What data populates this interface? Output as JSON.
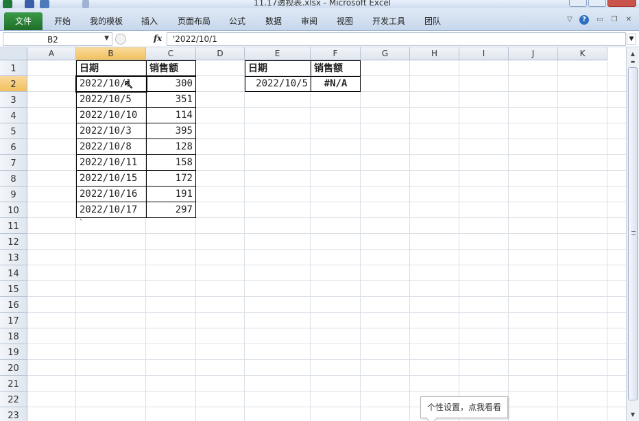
{
  "window": {
    "title": "11.17透视表.xlsx - Microsoft Excel",
    "accent": "#217346"
  },
  "ribbon": {
    "file_tab": "文件",
    "tabs": [
      "开始",
      "我的模板",
      "插入",
      "页面布局",
      "公式",
      "数据",
      "审阅",
      "视图",
      "开发工具",
      "团队"
    ]
  },
  "formula_bar": {
    "name_box": "B2",
    "fx_label": "fx",
    "formula": "'2022/10/1"
  },
  "columns": [
    "A",
    "B",
    "C",
    "D",
    "E",
    "F",
    "G",
    "H",
    "I",
    "J",
    "K"
  ],
  "rows": [
    "1",
    "2",
    "3",
    "4",
    "5",
    "6",
    "7",
    "8",
    "9",
    "10",
    "11",
    "12",
    "13",
    "14",
    "15",
    "16",
    "17",
    "18",
    "19",
    "20",
    "21",
    "22",
    "23"
  ],
  "active_cell": "B2",
  "table_left": {
    "headers": [
      "日期",
      "销售额"
    ],
    "rows": [
      [
        "2022/10/1",
        "300"
      ],
      [
        "2022/10/5",
        "351"
      ],
      [
        "2022/10/10",
        "114"
      ],
      [
        "2022/10/3",
        "395"
      ],
      [
        "2022/10/8",
        "128"
      ],
      [
        "2022/10/11",
        "158"
      ],
      [
        "2022/10/15",
        "172"
      ],
      [
        "2022/10/16",
        "191"
      ],
      [
        "2022/10/17",
        "297"
      ]
    ],
    "stray_mark": "`"
  },
  "table_right": {
    "headers": [
      "日期",
      "销售额"
    ],
    "row": [
      "2022/10/5",
      "#N/A"
    ]
  },
  "tooltip": "个性设置，点我看看"
}
